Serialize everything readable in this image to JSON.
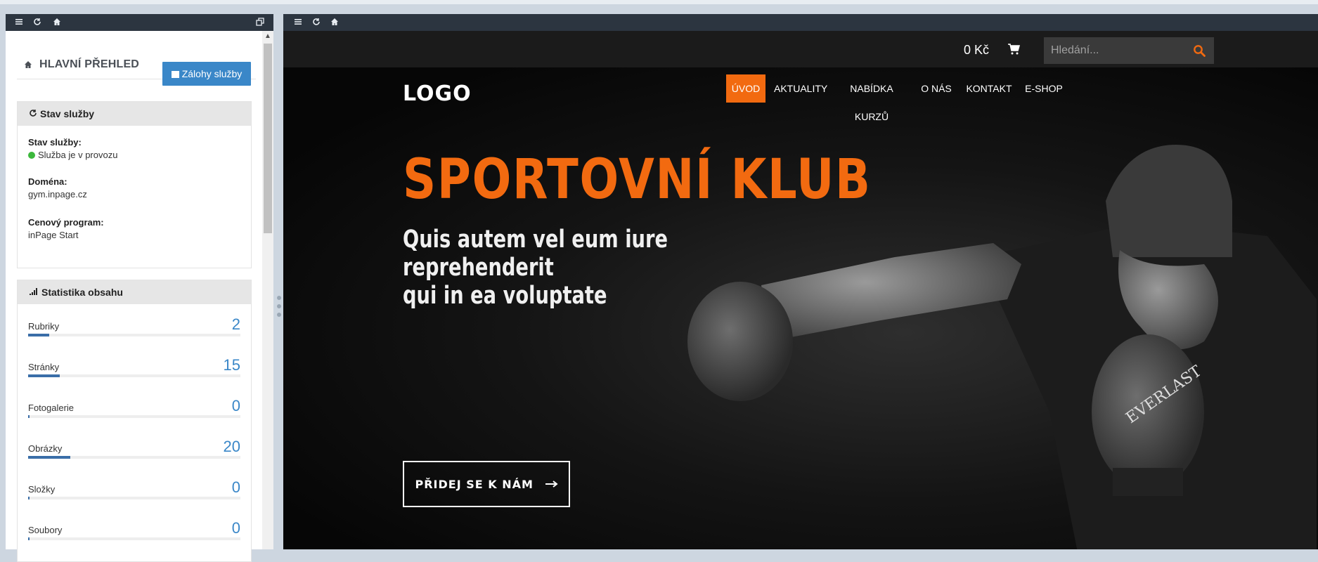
{
  "left_panel": {
    "toolbar_icons": [
      "menu-icon",
      "refresh-icon",
      "home-icon",
      "restore-window-icon"
    ],
    "header_title": "HLAVNÍ PŘEHLED",
    "backup_button_label": "Zálohy služby",
    "service_card": {
      "title": "Stav služby",
      "status_label": "Stav služby:",
      "status_value": "Služba je v provozu",
      "status_color": "#3cb83c",
      "domain_label": "Doména:",
      "domain_value": "gym.inpage.cz",
      "plan_label": "Cenový program:",
      "plan_value": "inPage Start"
    },
    "stats_card": {
      "title": "Statistika obsahu",
      "items": [
        {
          "label": "Rubriky",
          "value": "2",
          "fraction": 0.1
        },
        {
          "label": "Stránky",
          "value": "15",
          "fraction": 0.15
        },
        {
          "label": "Fotogalerie",
          "value": "0",
          "fraction": 0.005
        },
        {
          "label": "Obrázky",
          "value": "20",
          "fraction": 0.2
        },
        {
          "label": "Složky",
          "value": "0",
          "fraction": 0.005
        },
        {
          "label": "Soubory",
          "value": "0",
          "fraction": 0.005
        }
      ]
    }
  },
  "right_panel": {
    "toolbar_icons": [
      "menu-icon",
      "refresh-icon",
      "home-icon"
    ],
    "cart_price": "0 Kč",
    "search_placeholder": "Hledání...",
    "logo_text": "LOGO",
    "nav": [
      "ÚVOD",
      "AKTUALITY",
      "NABÍDKA KURZŮ",
      "O NÁS",
      "KONTAKT",
      "E-SHOP"
    ],
    "active_nav": "ÚVOD",
    "hero_title": "SPORTOVNÍ KLUB",
    "hero_subtitle_line1": "Quis autem vel eum iure reprehenderit",
    "hero_subtitle_line2": "qui in ea voluptate",
    "cta_label": "PŘIDEJ SE K NÁM",
    "accent_color": "#f26a10"
  }
}
